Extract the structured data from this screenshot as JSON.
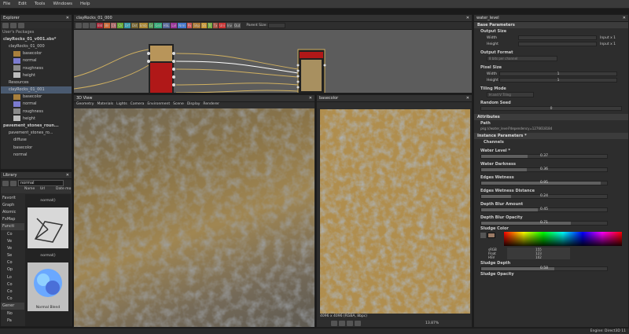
{
  "menu": [
    "File",
    "Edit",
    "Tools",
    "Windows",
    "Help"
  ],
  "explorer": {
    "title": "Explorer",
    "section": "User's Packages",
    "rows": [
      {
        "label": "clayRocks_01_v001.sbs*",
        "indent": 3,
        "color": "",
        "bold": true
      },
      {
        "label": "clayRocks_01_000",
        "indent": 10,
        "color": "",
        "bold": false
      },
      {
        "label": "basecolor",
        "indent": 16,
        "color": "#a87f3c",
        "bold": false
      },
      {
        "label": "normal",
        "indent": 16,
        "color": "#7b7bd0",
        "bold": false
      },
      {
        "label": "roughness",
        "indent": 16,
        "color": "#8a8a8a",
        "bold": false
      },
      {
        "label": "height",
        "indent": 16,
        "color": "#bdbdbd",
        "bold": false
      },
      {
        "label": "Resources",
        "indent": 10,
        "color": "",
        "bold": false
      },
      {
        "label": "clayRocks_01_001",
        "indent": 10,
        "color": "",
        "bold": false,
        "selected": true
      },
      {
        "label": "basecolor",
        "indent": 16,
        "color": "#a87f3c",
        "bold": false
      },
      {
        "label": "normal",
        "indent": 16,
        "color": "#7b7bd0",
        "bold": false
      },
      {
        "label": "roughness",
        "indent": 16,
        "color": "#8a8a8a",
        "bold": false
      },
      {
        "label": "height",
        "indent": 16,
        "color": "#bdbdbd",
        "bold": false
      },
      {
        "label": "pavement_stones_roun...",
        "indent": 3,
        "color": "",
        "bold": true
      },
      {
        "label": "pavement_stones_ro...",
        "indent": 10,
        "color": "",
        "bold": false
      },
      {
        "label": "diffuse",
        "indent": 16,
        "color": "",
        "bold": false
      },
      {
        "label": "basecolor",
        "indent": 16,
        "color": "",
        "bold": false
      },
      {
        "label": "normal",
        "indent": 16,
        "color": "",
        "bold": false
      }
    ]
  },
  "library": {
    "title": "Library",
    "search_value": "normal",
    "columns": [
      "Name",
      "Url",
      "Date mo"
    ],
    "categories": [
      "Favorit",
      "Graph",
      "Atomic",
      "FxMap",
      "Functi"
    ],
    "function_items": [
      "Co",
      "Ve",
      "Ve",
      "Se",
      "Co",
      "Op",
      "Lo",
      "Co",
      "Co",
      "Co"
    ],
    "generators": "Gener",
    "gen_items": [
      "No",
      "Pa"
    ],
    "thumb1_label": "normal()",
    "thumb2_label": "normal()",
    "thumb3_label": "Normal Blend"
  },
  "graph": {
    "tab": "clayRocks_01_000",
    "parent_size_label": "Parent Size:",
    "node_chips": [
      "Bld",
      "Blr",
      "Ch",
      "Clr",
      "Drf",
      "Dst",
      "Emb",
      "Gr",
      "Grd",
      "HSL",
      "Lvl",
      "Nrm",
      "Px",
      "Shp",
      "Sh",
      "Tr",
      "Tx",
      "Uni",
      "Inv",
      "Out"
    ]
  },
  "view3d": {
    "title": "3D View",
    "menu": [
      "Geometry",
      "Materials",
      "Lights",
      "Camera",
      "Environment",
      "Scene",
      "Display",
      "Renderer"
    ]
  },
  "view2d": {
    "title": "basecolor",
    "info": "4096 x 4096 (RGBA, 8bpc)",
    "zoom": "13.87%"
  },
  "props": {
    "title": "water_level",
    "base_parameters": "Base Parameters",
    "output_size": "Output Size",
    "width_label": "Width",
    "height_label": "Height",
    "width_value": "Input x 1",
    "height_value": "Input x 1",
    "output_format": "Output Format",
    "output_format_value": "8 bits per channel",
    "pixel_size": "Pixel Size",
    "px_width": "1",
    "px_height": "1",
    "tiling_mode": "Tiling Mode",
    "tiling_value": "H and V Tiling",
    "random_seed": "Random Seed",
    "random_seed_value": "0",
    "attributes": "Attributes",
    "path_label": "Path",
    "path_value": "pkg:///water_level?dependency=1276618184",
    "instance_parameters": "Instance Parameters *",
    "channels": "Channels",
    "sliders": [
      {
        "label": "Water Level *",
        "value": "0.37",
        "fill": 0.37
      },
      {
        "label": "Water Darkness",
        "value": "0.36",
        "fill": 0.36
      },
      {
        "label": "Edges Wetness",
        "value": "0.95",
        "fill": 0.95
      },
      {
        "label": "Edges Wetness Distance",
        "value": "0.24",
        "fill": 0.24
      },
      {
        "label": "Depth Blur Amount",
        "value": "0.45",
        "fill": 0.45
      },
      {
        "label": "Depth Blur Opacity",
        "value": "0.71",
        "fill": 0.71
      }
    ],
    "sludge_color": "Sludge Color",
    "rgb": {
      "r": "155",
      "g": "123",
      "b": "102"
    },
    "color_modes": [
      "sRGB",
      "Float",
      "HSV"
    ],
    "sludge_depth": "Sludge Depth",
    "sludge_depth_value": "0.58",
    "sludge_opacity": "Sludge Opacity",
    "swatch_color": "#9b7b66"
  },
  "status": "Engine: Direct3D 11"
}
